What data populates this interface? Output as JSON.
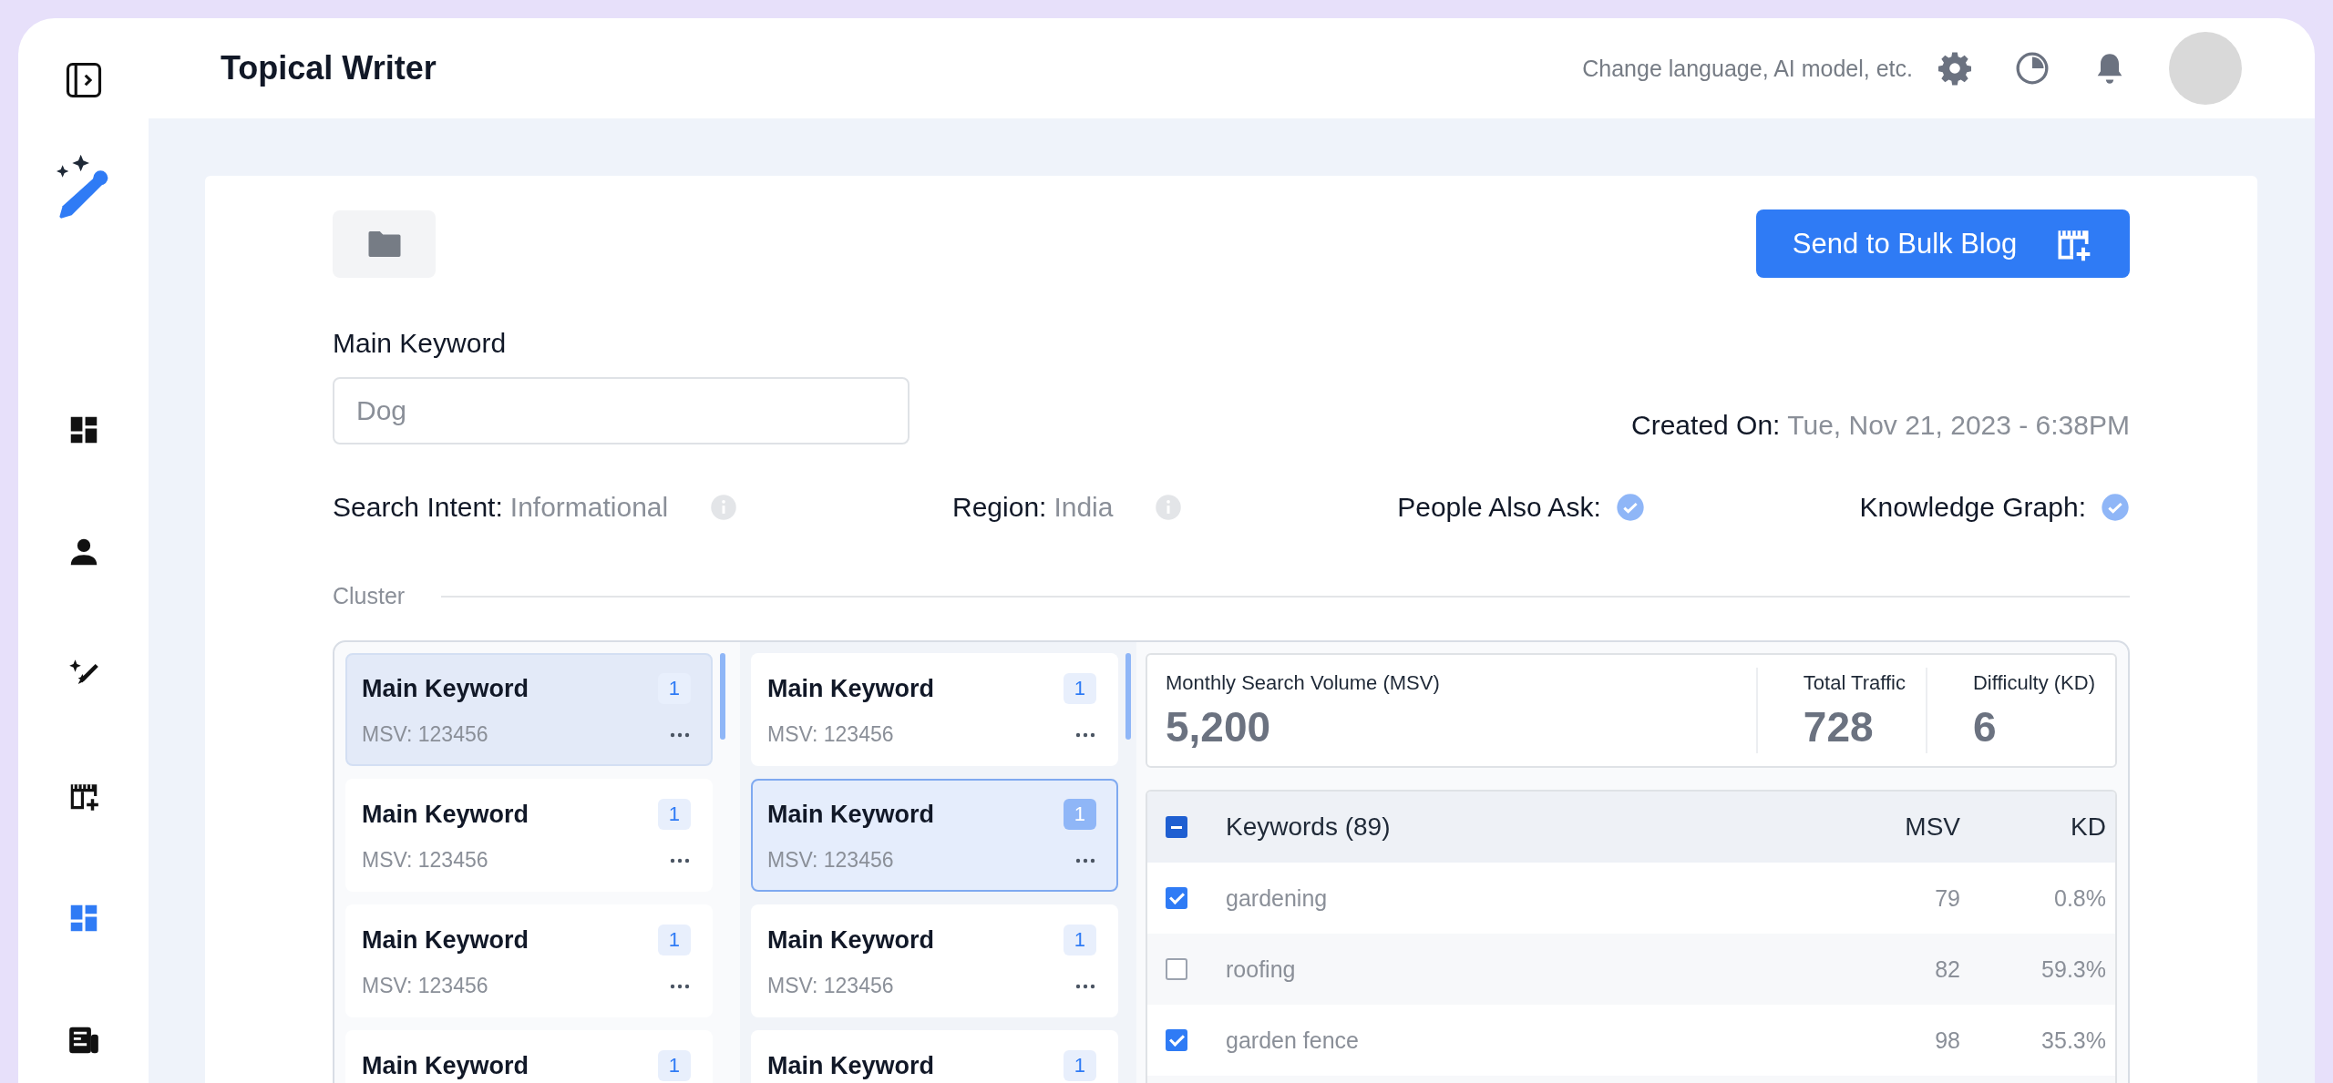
{
  "header": {
    "title": "Topical Writer",
    "settings_hint": "Change language, AI model, etc."
  },
  "sidebar": {
    "items": [
      {
        "kind": "dashboard",
        "selected": false
      },
      {
        "kind": "user",
        "selected": false
      },
      {
        "kind": "ai-pen",
        "selected": false
      },
      {
        "kind": "calendar-add",
        "selected": false
      },
      {
        "kind": "dashboard",
        "selected": true
      },
      {
        "kind": "news",
        "selected": false
      }
    ]
  },
  "toolbar": {
    "send_button": "Send to Bulk Blog"
  },
  "main_keyword": {
    "label": "Main Keyword",
    "value": "Dog"
  },
  "created_on": {
    "label": "Created On:",
    "value": "Tue, Nov 21, 2023 - 6:38PM"
  },
  "info": [
    {
      "kind": "info",
      "label": "Search Intent:",
      "value": "Informational"
    },
    {
      "kind": "info",
      "label": "Region:",
      "value": "India"
    },
    {
      "kind": "check",
      "label": "People Also Ask:",
      "checked": true
    },
    {
      "kind": "check",
      "label": "Knowledge Graph:",
      "checked": true
    }
  ],
  "cluster": {
    "label": "Cluster",
    "columns": [
      {
        "kind": "parent",
        "cards": [
          {
            "title": "Main Keyword",
            "count": "1",
            "msv": "MSV: 123456",
            "selected": true
          },
          {
            "title": "Main Keyword",
            "count": "1",
            "msv": "MSV: 123456",
            "selected": false
          },
          {
            "title": "Main Keyword",
            "count": "1",
            "msv": "MSV: 123456",
            "selected": false
          },
          {
            "title": "Main Keyword",
            "count": "1",
            "selected": false
          }
        ]
      },
      {
        "kind": "child",
        "cards": [
          {
            "title": "Main Keyword",
            "count": "1",
            "msv": "MSV: 123456",
            "selected": false
          },
          {
            "title": "Main Keyword",
            "count": "1",
            "msv": "MSV: 123456",
            "selected": true
          },
          {
            "title": "Main Keyword",
            "count": "1",
            "msv": "MSV: 123456",
            "selected": false
          },
          {
            "title": "Main Keyword",
            "count": "1",
            "selected": false
          }
        ]
      }
    ],
    "stats": [
      {
        "label": "Monthly Search Volume (MSV)",
        "value": "5,200"
      },
      {
        "label": "Total Traffic",
        "value": "728"
      },
      {
        "label": "Difficulty (KD)",
        "value": "6"
      }
    ],
    "keywords": {
      "columns": [
        "Keywords (89)",
        "MSV",
        "KD"
      ],
      "indeterminate": true,
      "rows": [
        {
          "keyword": "gardening",
          "msv": "79",
          "kd": "0.8%",
          "checked": true
        },
        {
          "keyword": "roofing",
          "msv": "82",
          "kd": "59.3%",
          "checked": false
        },
        {
          "keyword": "garden fence",
          "msv": "98",
          "kd": "35.3%",
          "checked": true
        }
      ]
    }
  }
}
